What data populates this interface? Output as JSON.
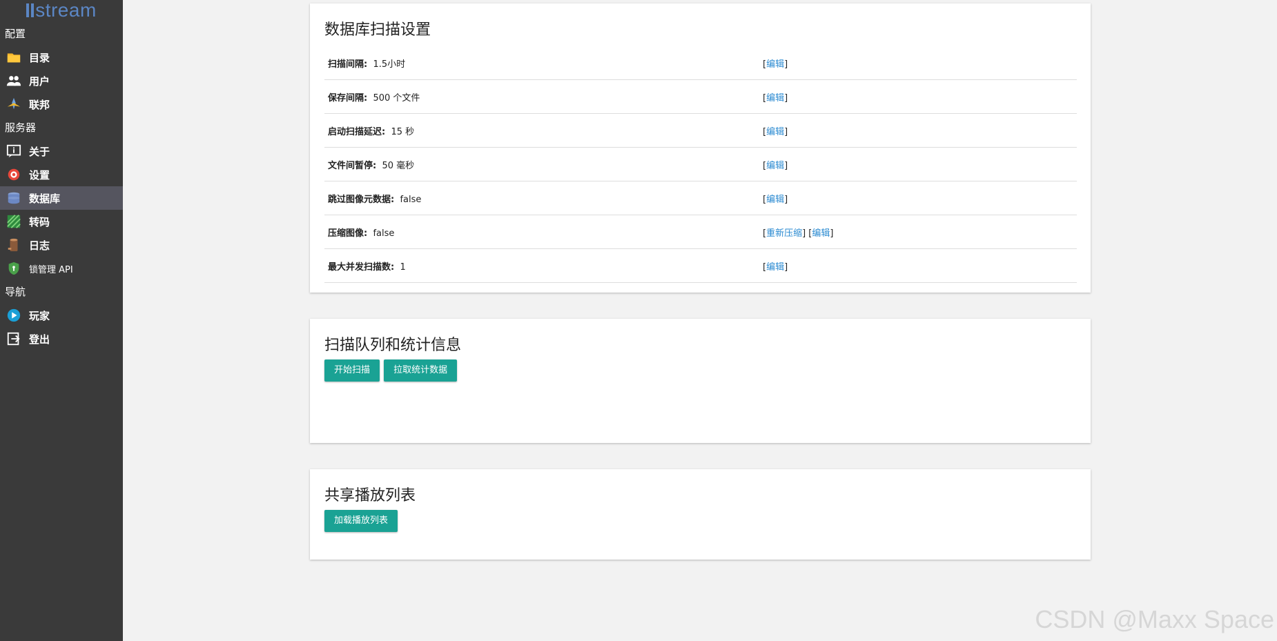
{
  "sidebar": {
    "logo_text": "stream",
    "sections": [
      {
        "title": "配置",
        "items": [
          {
            "label": "目录",
            "icon": "folder-icon"
          },
          {
            "label": "用户",
            "icon": "users-icon"
          },
          {
            "label": "联邦",
            "icon": "federation-icon"
          }
        ]
      },
      {
        "title": "服务器",
        "items": [
          {
            "label": "关于",
            "icon": "info-icon"
          },
          {
            "label": "设置",
            "icon": "gear-icon"
          },
          {
            "label": "数据库",
            "icon": "database-icon",
            "active": true
          },
          {
            "label": "转码",
            "icon": "transcode-icon"
          },
          {
            "label": "日志",
            "icon": "log-icon"
          },
          {
            "label": "锁管理 API",
            "icon": "shield-lock-icon"
          }
        ]
      },
      {
        "title": "导航",
        "items": [
          {
            "label": "玩家",
            "icon": "play-icon"
          },
          {
            "label": "登出",
            "icon": "logout-icon"
          }
        ]
      }
    ]
  },
  "scan_settings": {
    "title": "数据库扫描设置",
    "edit_label": "编辑",
    "recompress_label": "重新压缩",
    "rows": [
      {
        "label": "扫描间隔:",
        "value": "1.5小时"
      },
      {
        "label": "保存间隔:",
        "value": "500 个文件"
      },
      {
        "label": "启动扫描延迟:",
        "value": "15 秒"
      },
      {
        "label": "文件间暂停:",
        "value": "50 毫秒"
      },
      {
        "label": "跳过图像元数据:",
        "value": "false"
      },
      {
        "label": "压缩图像:",
        "value": "false"
      },
      {
        "label": "最大并发扫描数:",
        "value": "1"
      }
    ]
  },
  "scan_queue": {
    "title": "扫描队列和统计信息",
    "start_scan_label": "开始扫描",
    "pull_stats_label": "拉取统计数据"
  },
  "shared_playlists": {
    "title": "共享播放列表",
    "load_label": "加载播放列表"
  },
  "watermark": "CSDN @Maxx Space",
  "colors": {
    "sidebar_bg": "#3a3a3a",
    "accent": "#1aa294",
    "link": "#2a8ad1",
    "active_item": "#55555f"
  }
}
